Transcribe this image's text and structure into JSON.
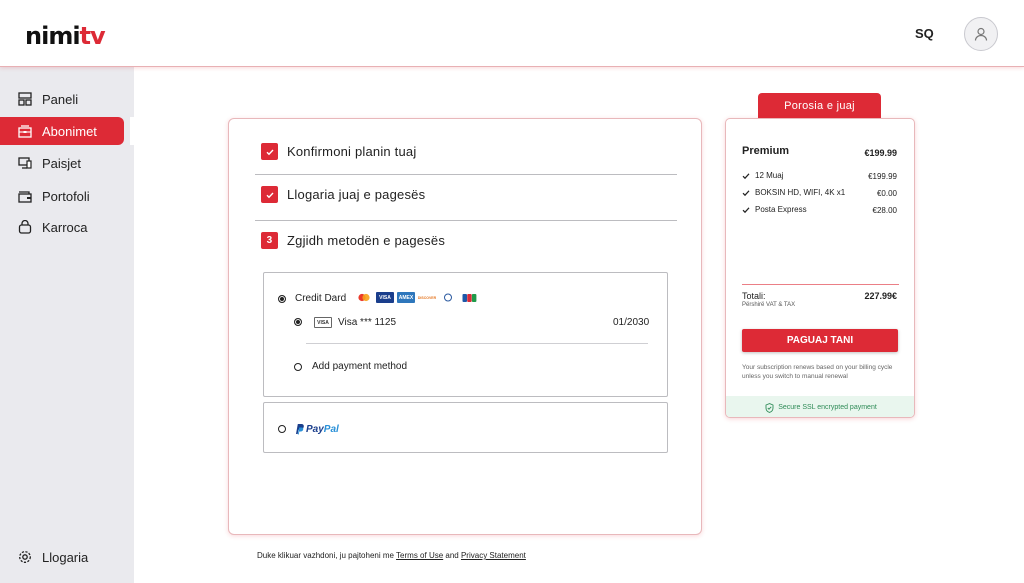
{
  "header": {
    "logo_main": "nimi",
    "logo_accent": "tv",
    "language": "SQ"
  },
  "sidebar": {
    "items": [
      {
        "label": "Paneli",
        "icon": "dashboard-icon"
      },
      {
        "label": "Abonimet",
        "icon": "subscription-icon"
      },
      {
        "label": "Paisjet",
        "icon": "devices-icon"
      },
      {
        "label": "Portofoli",
        "icon": "wallet-icon"
      },
      {
        "label": "Karroca",
        "icon": "cart-icon"
      }
    ],
    "account_label": "Llogaria"
  },
  "steps": [
    {
      "label": "Konfirmoni planin tuaj",
      "marker": "check"
    },
    {
      "label": "Llogaria juaj e pagesës",
      "marker": "check"
    },
    {
      "label": "Zgjidh metodën e pagesës",
      "marker": "3"
    }
  ],
  "payment": {
    "credit_label": "Credit Dard",
    "card_brand_mini": "VISA",
    "saved_card": "Visa *** 1125",
    "saved_expiry": "01/2030",
    "add_method": "Add payment method",
    "brands": [
      "mastercard",
      "VISA",
      "AMEX",
      "DISCOVER",
      "diners",
      "JCB"
    ],
    "paypal_a": "Pay",
    "paypal_b": "Pal"
  },
  "footer": {
    "prefix": "Duke klikuar vazhdoni, ju pajtoheni me ",
    "terms": "Terms of Use",
    "and": " and ",
    "privacy": "Privacy Statement"
  },
  "order": {
    "tab": "Porosia e juaj",
    "plan": "Premium",
    "plan_price": "€199.99",
    "items": [
      {
        "label": "12 Muaj",
        "price": "€199.99"
      },
      {
        "label": "BOKSIN HD, WIFI, 4K x1",
        "price": "€0.00"
      },
      {
        "label": "Posta Express",
        "price": "€28.00"
      }
    ],
    "total_label": "Totali:",
    "total_note": "Përshirë VAT & TAX",
    "total_value": "227.99€",
    "pay_button": "PAGUAJ TANI",
    "renew_note": "Your subscription renews based on your billing cycle unless you switch to manual renewal",
    "ssl": "Secure SSL encrypted payment"
  },
  "colors": {
    "accent": "#dd2a36",
    "sidebar_bg": "#eaeaee",
    "ssl_green": "#2e8b57"
  }
}
